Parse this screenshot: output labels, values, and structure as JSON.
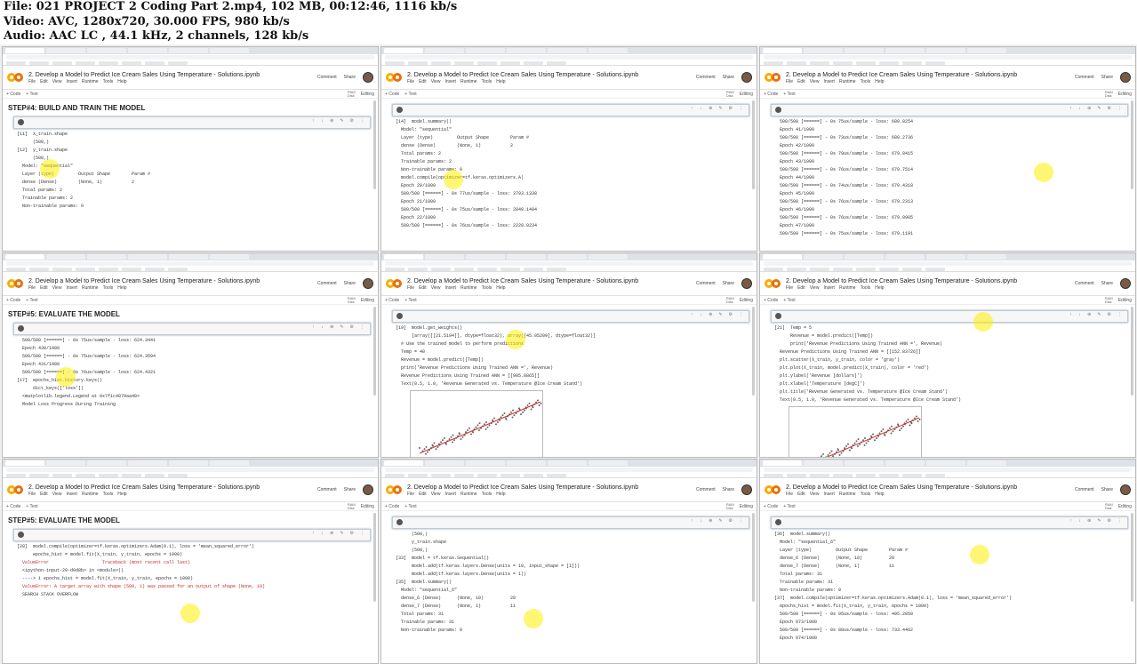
{
  "header": {
    "line1": "File: 021 PROJECT 2 Coding Part 2.mp4, 102 MB, 00:12:46, 1116 kb/s",
    "line2": "Video: AVC, 1280x720, 30.000 FPS, 980 kb/s",
    "line3": "Audio: AAC LC , 44.1 kHz, 2 channels, 128 kb/s"
  },
  "notebook": {
    "title": "2. Develop a Model to Predict Ice Cream Sales Using Temperature - Solutions.ipynb",
    "menus": [
      "File",
      "Edit",
      "View",
      "Insert",
      "Runtime",
      "Tools",
      "Help"
    ],
    "comment": "Comment",
    "share": "Share",
    "code_btn": "+ Code",
    "text_btn": "+ Text",
    "ram": "RAM",
    "disk": "Disk",
    "editing": "Editing"
  },
  "tiles": [
    {
      "step": "STEP#4: BUILD AND TRAIN THE MODEL",
      "lines": [
        "[11]  X_train.shape",
        "      (500,)",
        "[12]  y_train.shape",
        "      (500,)",
        "  Model: \"sequential\"",
        "  Layer (type)         Output Shape        Param #",
        "  dense (Dense)        (None, 1)           2",
        "  Total params: 2",
        "  Trainable params: 2",
        "  Non-trainable params: 0"
      ]
    },
    {
      "step": "",
      "lines": [
        "[14]  model.summary()",
        "  Model: \"sequential\"",
        "  Layer (type)         Output Shape        Param #",
        "  dense (Dense)        (None, 1)           2",
        "  Total params: 2",
        "  Trainable params: 2",
        "  Non-trainable params: 0",
        "  model.compile(optimizer=tf.keras.optimizers.A)",
        "  Epoch 20/1000",
        "  500/500 [======] - 0s 77us/sample - loss: 3793.1338",
        "  Epoch 21/1000",
        "  500/500 [======] - 0s 75us/sample - loss: 2849.1404",
        "  Epoch 22/1000",
        "  500/500 [======] - 0s 76us/sample - loss: 2220.0234"
      ]
    },
    {
      "step": "",
      "lines": [
        "  500/500 [======] - 0s 75us/sample - loss: 680.8254",
        "  Epoch 41/1000",
        "  500/500 [======] - 0s 73us/sample - loss: 680.2736",
        "  Epoch 42/1000",
        "  500/500 [======] - 0s 79us/sample - loss: 679.8415",
        "  Epoch 43/1000",
        "  500/500 [======] - 0s 76us/sample - loss: 679.7514",
        "  Epoch 44/1000",
        "  500/500 [======] - 0s 74us/sample - loss: 679.4318",
        "  Epoch 45/1000",
        "  500/500 [======] - 0s 76us/sample - loss: 679.2313",
        "  Epoch 46/1000",
        "  500/500 [======] - 0s 76us/sample - loss: 679.0985",
        "  Epoch 47/1000",
        "  500/500 [======] - 0s 75us/sample - loss: 679.1191"
      ]
    },
    {
      "step": "STEP#5: EVALUATE THE MODEL",
      "lines": [
        "  500/500 [======] - 0s 75us/sample - loss: 624.3441",
        "  Epoch 430/1000",
        "  500/500 [======] - 0s 75us/sample - loss: 624.3594",
        "  Epoch 431/1000",
        "  500/500 [======] - 0s 76us/sample - loss: 624.4321",
        "[17]  epochs_hist.history.keys()",
        "      dict_keys(['loss'])",
        "  <matplotlib.legend.Legend at 0x7f1c4079aa40>",
        "  Model Loss Progress During Training"
      ]
    },
    {
      "step": "",
      "lines": [
        "[19]  model.get_weights()",
        "      [array([[21.5194]], dtype=float32), array([45.05209], dtype=float32)]",
        "  # Use the trained model to perform predictions",
        "  Temp = 40",
        "  Revenue = model.predict([Temp])",
        "  print('Revenue Predictions Using Trained ANN =', Revenue)",
        "  Revenue Predictions Using Trained ANN = [[905.8865]]",
        "  Text(0.5, 1.0, 'Revenue Generated vs. Temperature @Ice Cream Stand')"
      ]
    },
    {
      "step": "",
      "lines": [
        "[21]  Temp = 5",
        "      Revenue = model.predict([Temp])",
        "      print('Revenue Predictions Using Trained ANN =', Revenue)",
        "  Revenue Predictions Using Trained ANN = [[152.83726]]",
        "  plt.scatter(X_train, y_train, color = 'gray')",
        "  plt.plot(X_train, model.predict(X_train), color = 'red')",
        "  plt.ylabel('Revenue [dollars]')",
        "  plt.xlabel('Temperature [degC]')",
        "  plt.title('Revenue Generated vs. Temperature @Ice Cream Stand')",
        "  Text(0.5, 1.0, 'Revenue Generated vs. Temperature @Ice Cream Stand')"
      ]
    },
    {
      "step": "STEP#5: EVALUATE THE MODEL",
      "lines": [
        "[28]  model.compile(optimizer=tf.keras.optimizers.Adam(0.1), loss = 'mean_squared_error')",
        "      epochs_hist = model.fit(X_train, y_train, epochs = 1000)",
        "  ValueError                    Traceback (most recent call last)",
        "  <ipython-input-29-d9d8b> in <module>()",
        "  ----> 1 epochs_hist = model.fit(X_train, y_train, epochs = 1000)",
        "  ValueError: A target array with shape (500, 1) was passed for an output of shape (None, 10)",
        "  SEARCH STACK OVERFLOW"
      ]
    },
    {
      "step": "",
      "lines": [
        "      (500,)",
        "      y_train.shape",
        "      (500,)",
        "[33]  model = tf.keras.Sequential()",
        "      model.add(tf.keras.layers.Dense(units = 10, input_shape = [1]))",
        "      model.add(tf.keras.layers.Dense(units = 1))",
        "[35]  model.summary()",
        "  Model: \"sequential_6\"",
        "  dense_6 (Dense)      (None, 10)          20",
        "  dense_7 (Dense)      (None, 1)           11",
        "  Total params: 31",
        "  Trainable params: 31",
        "  Non-trainable params: 0"
      ]
    },
    {
      "step": "",
      "lines": [
        "[36]  model.summary()",
        "  Model: \"sequential_6\"",
        "  Layer (type)         Output Shape        Param #",
        "  dense_6 (Dense)      (None, 10)          20",
        "  dense_7 (Dense)      (None, 1)           11",
        "  Total params: 31",
        "  Trainable params: 31",
        "  Non-trainable params: 0",
        "[37]  model.compile(optimizer=tf.keras.optimizers.Adam(0.1), loss = 'mean_squared_error')",
        "  epochs_hist = model.fit(X_train, y_train, epochs = 1000)",
        "  500/500 [======] - 0s 95us/sample - loss: 495.2850",
        "  Epoch 973/1000",
        "  500/500 [======] - 0s 80us/sample - loss: 733.4462",
        "  Epoch 974/1000"
      ]
    }
  ]
}
